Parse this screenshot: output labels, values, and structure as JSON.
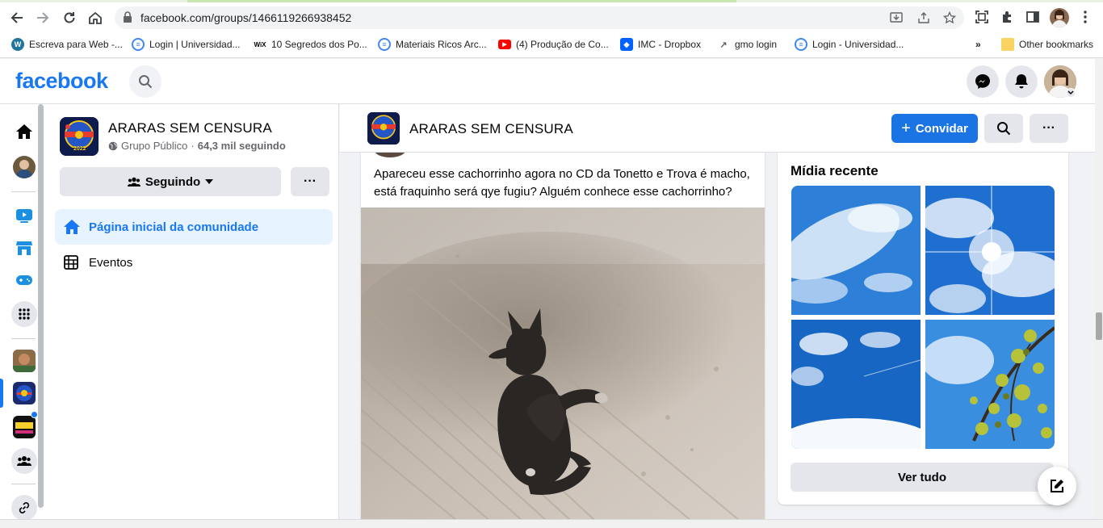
{
  "browser": {
    "url": "facebook.com/groups/1466119266938452",
    "bookmarks": [
      {
        "label": "Escreva para Web -...",
        "icon": "wordpress-icon",
        "color": "#21759b"
      },
      {
        "label": "Login | Universidad...",
        "icon": "doc-icon",
        "color": "#4285f4"
      },
      {
        "label": "10 Segredos dos Po...",
        "icon": "wix-icon",
        "color": "#000000"
      },
      {
        "label": "Materiais Ricos Arc...",
        "icon": "doc-icon",
        "color": "#4285f4"
      },
      {
        "label": "(4) Produção de Co...",
        "icon": "youtube-icon",
        "color": "#ff0000"
      },
      {
        "label": "IMC - Dropbox",
        "icon": "dropbox-icon",
        "color": "#0061ff"
      },
      {
        "label": "gmo login",
        "icon": "arrow-icon",
        "color": "#5f6368"
      },
      {
        "label": "Login - Universidad...",
        "icon": "doc-icon",
        "color": "#4285f4"
      }
    ],
    "more_bookmarks": "»",
    "other_bookmarks": "Other bookmarks"
  },
  "facebook": {
    "logo": "facebook",
    "brand_color": "#1877f2"
  },
  "group": {
    "name": "ARARAS SEM CENSURA",
    "privacy": "Grupo Público",
    "separator": "·",
    "followers": "64,3 mil seguindo",
    "following_button": "Seguindo",
    "more_button": "···",
    "thumb_year": "2022",
    "nav": {
      "home": "Página inicial da comunidade",
      "events": "Eventos"
    }
  },
  "sticky_header": {
    "name": "ARARAS SEM CENSURA",
    "invite_button": "Convidar",
    "invite_plus": "+",
    "more_button": "···"
  },
  "post": {
    "text": "Apareceu esse cachorrinho agora no CD da Tonetto e Trova é macho, está fraquinho será qye fugiu? Alguém conhece esse cachorrinho?"
  },
  "media": {
    "title": "Mídia recente",
    "see_all": "Ver tudo"
  },
  "colors": {
    "accent": "#1b74e4",
    "nav_active_bg": "#e7f3ff",
    "button_gray": "#e4e6eb",
    "page_bg": "#f0f2f5"
  }
}
